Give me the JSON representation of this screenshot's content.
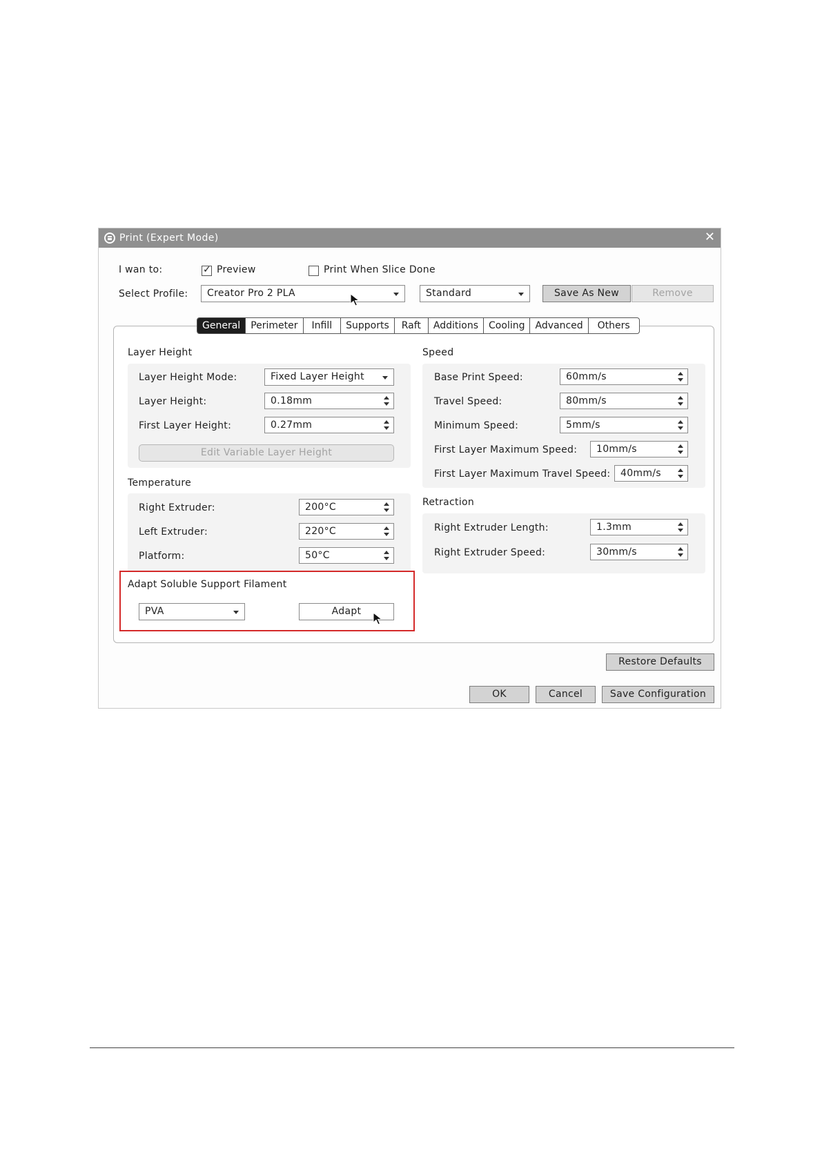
{
  "window": {
    "title": "Print (Expert Mode)"
  },
  "options": {
    "i_want_to_label": "I wan to:",
    "preview_label": "Preview",
    "preview_checked": true,
    "print_when_slice_done_label": "Print When Slice Done",
    "print_when_slice_done_checked": false
  },
  "profile": {
    "label": "Select Profile:",
    "value": "Creator Pro 2 PLA",
    "quality": "Standard",
    "save_as_new": "Save As New",
    "remove": "Remove"
  },
  "tabs": [
    "General",
    "Perimeter",
    "Infill",
    "Supports",
    "Raft",
    "Additions",
    "Cooling",
    "Advanced",
    "Others"
  ],
  "active_tab": "General",
  "layer_height": {
    "title": "Layer Height",
    "mode_label": "Layer Height Mode:",
    "mode_value": "Fixed Layer Height",
    "height_label": "Layer Height:",
    "height_value": "0.18mm",
    "first_label": "First Layer Height:",
    "first_value": "0.27mm",
    "edit_variable": "Edit Variable Layer Height"
  },
  "temperature": {
    "title": "Temperature",
    "right_label": "Right Extruder:",
    "right_value": "200°C",
    "left_label": "Left Extruder:",
    "left_value": "220°C",
    "platform_label": "Platform:",
    "platform_value": "50°C"
  },
  "soluble": {
    "title": "Adapt Soluble Support Filament",
    "filament": "PVA",
    "adapt": "Adapt"
  },
  "speed": {
    "title": "Speed",
    "base_label": "Base Print Speed:",
    "base_value": "60mm/s",
    "travel_label": "Travel Speed:",
    "travel_value": "80mm/s",
    "min_label": "Minimum Speed:",
    "min_value": "5mm/s",
    "first_max_label": "First Layer Maximum Speed:",
    "first_max_value": "10mm/s",
    "first_travel_label": "First Layer Maximum Travel Speed:",
    "first_travel_value": "40mm/s"
  },
  "retraction": {
    "title": "Retraction",
    "length_label": "Right Extruder Length:",
    "length_value": "1.3mm",
    "speed_label": "Right Extruder Speed:",
    "speed_value": "30mm/s"
  },
  "footer": {
    "restore_defaults": "Restore Defaults",
    "ok": "OK",
    "cancel": "Cancel",
    "save_configuration": "Save Configuration"
  },
  "colors": {
    "titlebar": "#8f8f8f",
    "active_tab": "#1e1e1e",
    "highlight": "#d42a2a"
  }
}
